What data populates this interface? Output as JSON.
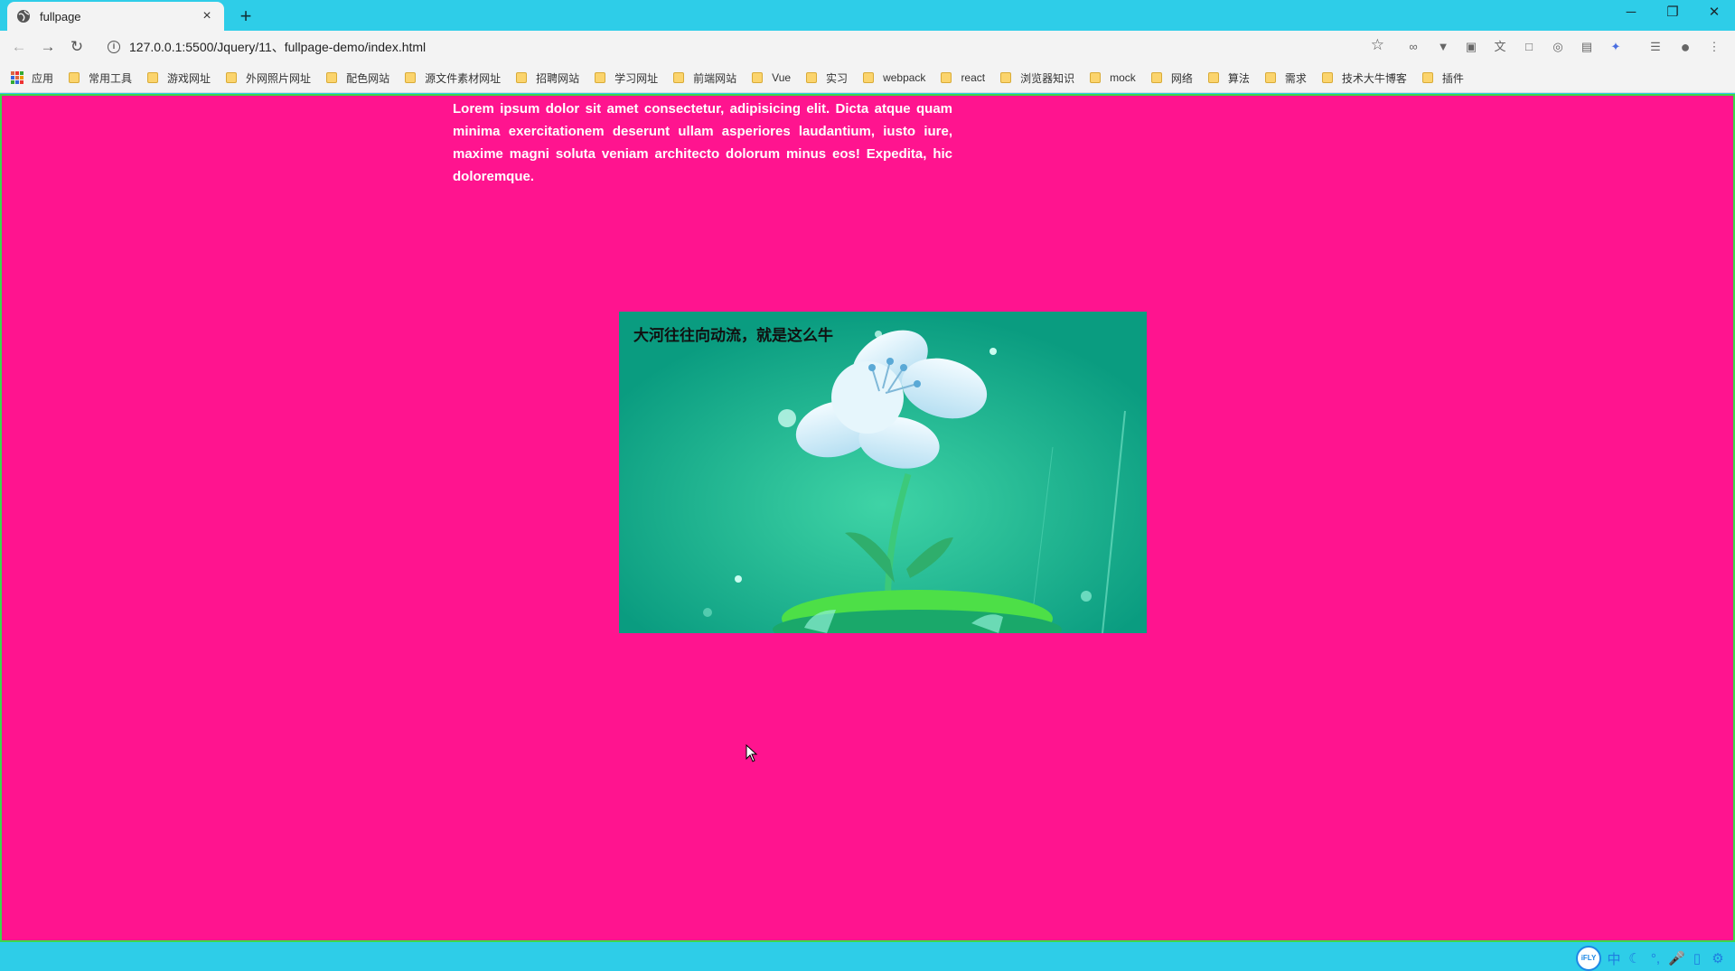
{
  "browser": {
    "tab_title": "fullpage",
    "tab_close": "×",
    "new_tab": "+",
    "url": "127.0.0.1:5500/Jquery/11、fullpage-demo/index.html",
    "window_controls": {
      "minimize": "─",
      "restore": "❐",
      "close": "✕"
    },
    "nav": {
      "back": "←",
      "forward": "→",
      "reload": "↻"
    },
    "star": "☆",
    "extensions": [
      "∞",
      "▼",
      "▣",
      "文",
      "□",
      "◎",
      "▤",
      "✦",
      "☰",
      "●",
      "⋮"
    ]
  },
  "bookmarks": {
    "apps_label": "应用",
    "items": [
      "常用工具",
      "游戏网址",
      "外网照片网址",
      "配色网站",
      "源文件素材网址",
      "招聘网站",
      "学习网址",
      "前端网站",
      "Vue",
      "实习",
      "webpack",
      "react",
      "浏览器知识",
      "mock",
      "网络",
      "算法",
      "需求",
      "技术大牛博客",
      "插件"
    ]
  },
  "page": {
    "lorem": "Lorem ipsum dolor sit amet consectetur, adipisicing elit. Dicta atque quam minima exercitationem deserunt ullam asperiores laudantium, iusto iure, maxime magni soluta veniam architecto dolorum minus eos! Expedita, hic doloremque.",
    "banner_caption": "大河往往向动流，就是这么牛"
  },
  "ime_toolbar": {
    "logo": "iFLY",
    "items": [
      "中",
      "☾",
      "°,",
      "🎤",
      "▯",
      "⚙"
    ]
  }
}
